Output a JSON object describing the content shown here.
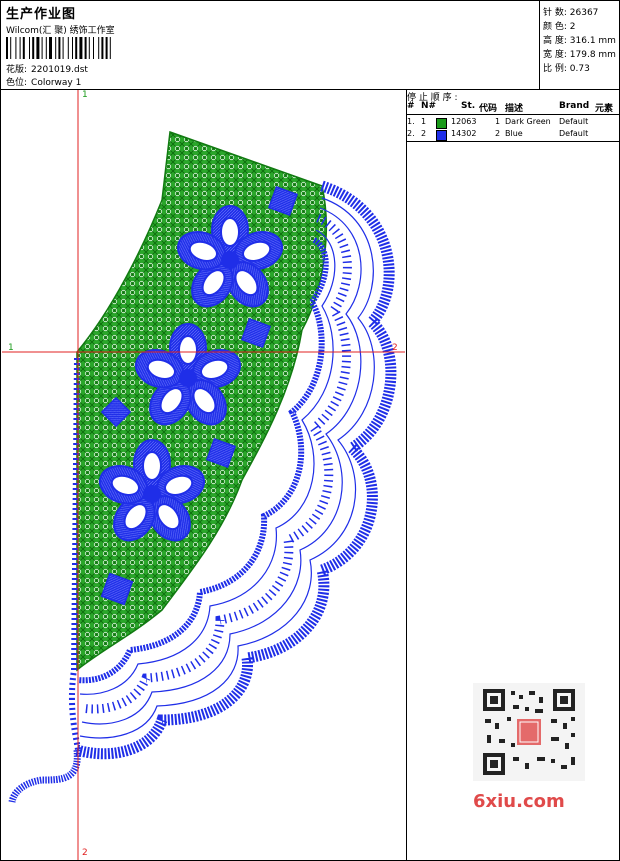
{
  "header": {
    "title": "生产作业图",
    "company": "Wilcom(汇 聚) 绣饰工作室",
    "file_label": "花版:",
    "file_name": "2201019.dst",
    "colorway_label": "色位:",
    "colorway": "Colorway 1"
  },
  "stats": [
    {
      "label": "针 数:",
      "value": "26367"
    },
    {
      "label": "颜 色:",
      "value": "2"
    },
    {
      "label": "高 度:",
      "value": "316.1 mm"
    },
    {
      "label": "宽 度:",
      "value": "179.8 mm"
    },
    {
      "label": "比 例:",
      "value": "0.73"
    }
  ],
  "panel": {
    "title": "停 止 顺 序 :",
    "columns": [
      "#",
      "N#",
      "St.",
      "代码",
      "描述",
      "Brand",
      "元素"
    ],
    "rows": [
      {
        "index": "1.",
        "n": "1",
        "color": "#1a9a1a",
        "stitches": "12063",
        "code": "1",
        "desc": "Dark Green",
        "brand": "Default"
      },
      {
        "index": "2.",
        "n": "2",
        "color": "#1f2ee8",
        "stitches": "14302",
        "code": "2",
        "desc": "Blue",
        "brand": "Default"
      }
    ]
  },
  "axes": {
    "top": "1",
    "bottom": "2",
    "left": "1",
    "right": "2"
  },
  "watermark": "6xiu.com",
  "colors": {
    "green": "#1a9a1a",
    "blue": "#1f2ee8",
    "axis": "#e02020"
  }
}
